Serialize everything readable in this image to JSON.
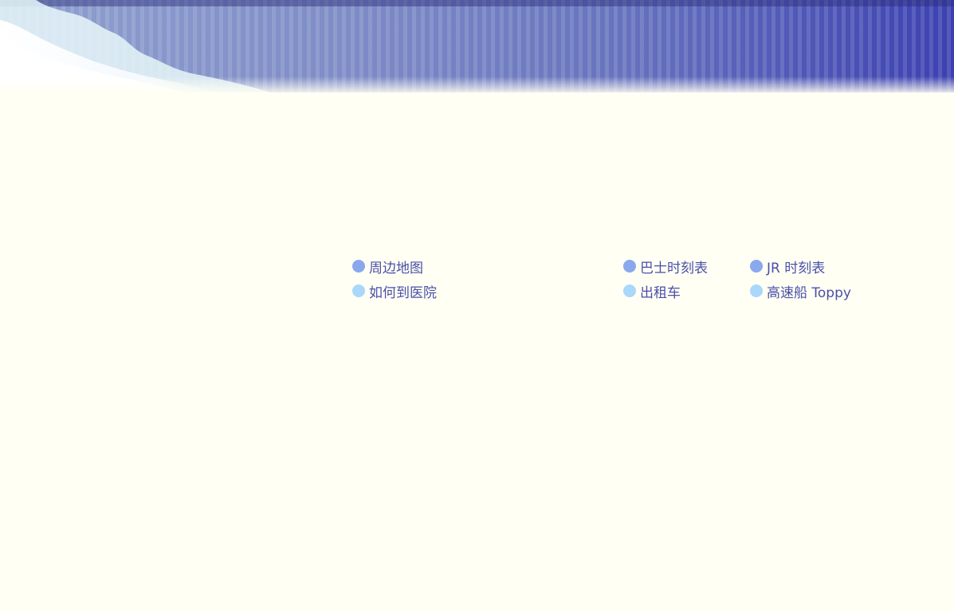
{
  "nav": {
    "row1": [
      {
        "label": "周边地图",
        "icon": "circle-bullet-blue",
        "color": "#8aa8ee"
      },
      {
        "label": "巴士时刻表",
        "icon": "circle-bullet-blue",
        "color": "#8aa8ee"
      },
      {
        "label": "JR 时刻表",
        "icon": "circle-bullet-blue",
        "color": "#8aa8ee"
      }
    ],
    "row2": [
      {
        "label": "如何到医院",
        "icon": "circle-bullet-light-blue",
        "color": "#a9d8fb"
      },
      {
        "label": "出租车",
        "icon": "circle-bullet-light-blue",
        "color": "#a9d8fb"
      },
      {
        "label": "高速船 Toppy",
        "icon": "circle-bullet-light-blue",
        "color": "#a9d8fb"
      }
    ]
  },
  "colors": {
    "background": "#fffff4",
    "link_text": "#4a4fa8",
    "banner_dark": "#3c41b1",
    "banner_light": "#8fa0cf"
  }
}
